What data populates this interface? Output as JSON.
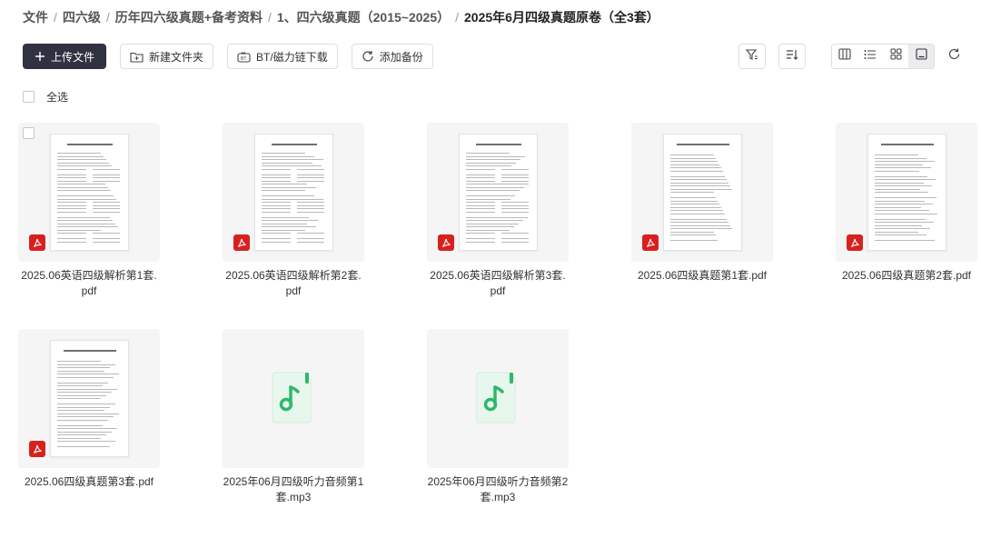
{
  "breadcrumb": {
    "items": [
      "文件",
      "四六级",
      "历年四六级真题+备考资料",
      "1、四六级真题（2015~2025）"
    ],
    "current": "2025年6月四级真题原卷（全3套）"
  },
  "toolbar": {
    "upload_label": "上传文件",
    "new_folder_label": "新建文件夹",
    "bt_download_label": "BT/磁力链下载",
    "add_backup_label": "添加备份"
  },
  "selection": {
    "select_all_label": "全选"
  },
  "files": [
    {
      "name": "2025.06英语四级解析第1套.pdf",
      "type": "pdf"
    },
    {
      "name": "2025.06英语四级解析第2套.pdf",
      "type": "pdf"
    },
    {
      "name": "2025.06英语四级解析第3套.pdf",
      "type": "pdf"
    },
    {
      "name": "2025.06四级真题第1套.pdf",
      "type": "pdf"
    },
    {
      "name": "2025.06四级真题第2套.pdf",
      "type": "pdf"
    },
    {
      "name": "2025.06四级真题第3套.pdf",
      "type": "pdf"
    },
    {
      "name": "2025年06月四级听力音频第1套.mp3",
      "type": "audio"
    },
    {
      "name": "2025年06月四级听力音频第2套.mp3",
      "type": "audio"
    }
  ],
  "icons": {
    "upload": "plus-icon",
    "new_folder": "folder-plus-icon",
    "bt": "magnet-icon",
    "backup": "sync-icon",
    "filter": "filter-icon",
    "sort": "sort-icon",
    "views": [
      "column-view-icon",
      "list-view-icon",
      "grid-view-icon",
      "thumbnail-view-icon"
    ],
    "refresh": "refresh-icon"
  },
  "colors": {
    "primary_button": "#303241",
    "pdf_badge": "#d8211f",
    "audio_icon": "#2fb76a"
  }
}
